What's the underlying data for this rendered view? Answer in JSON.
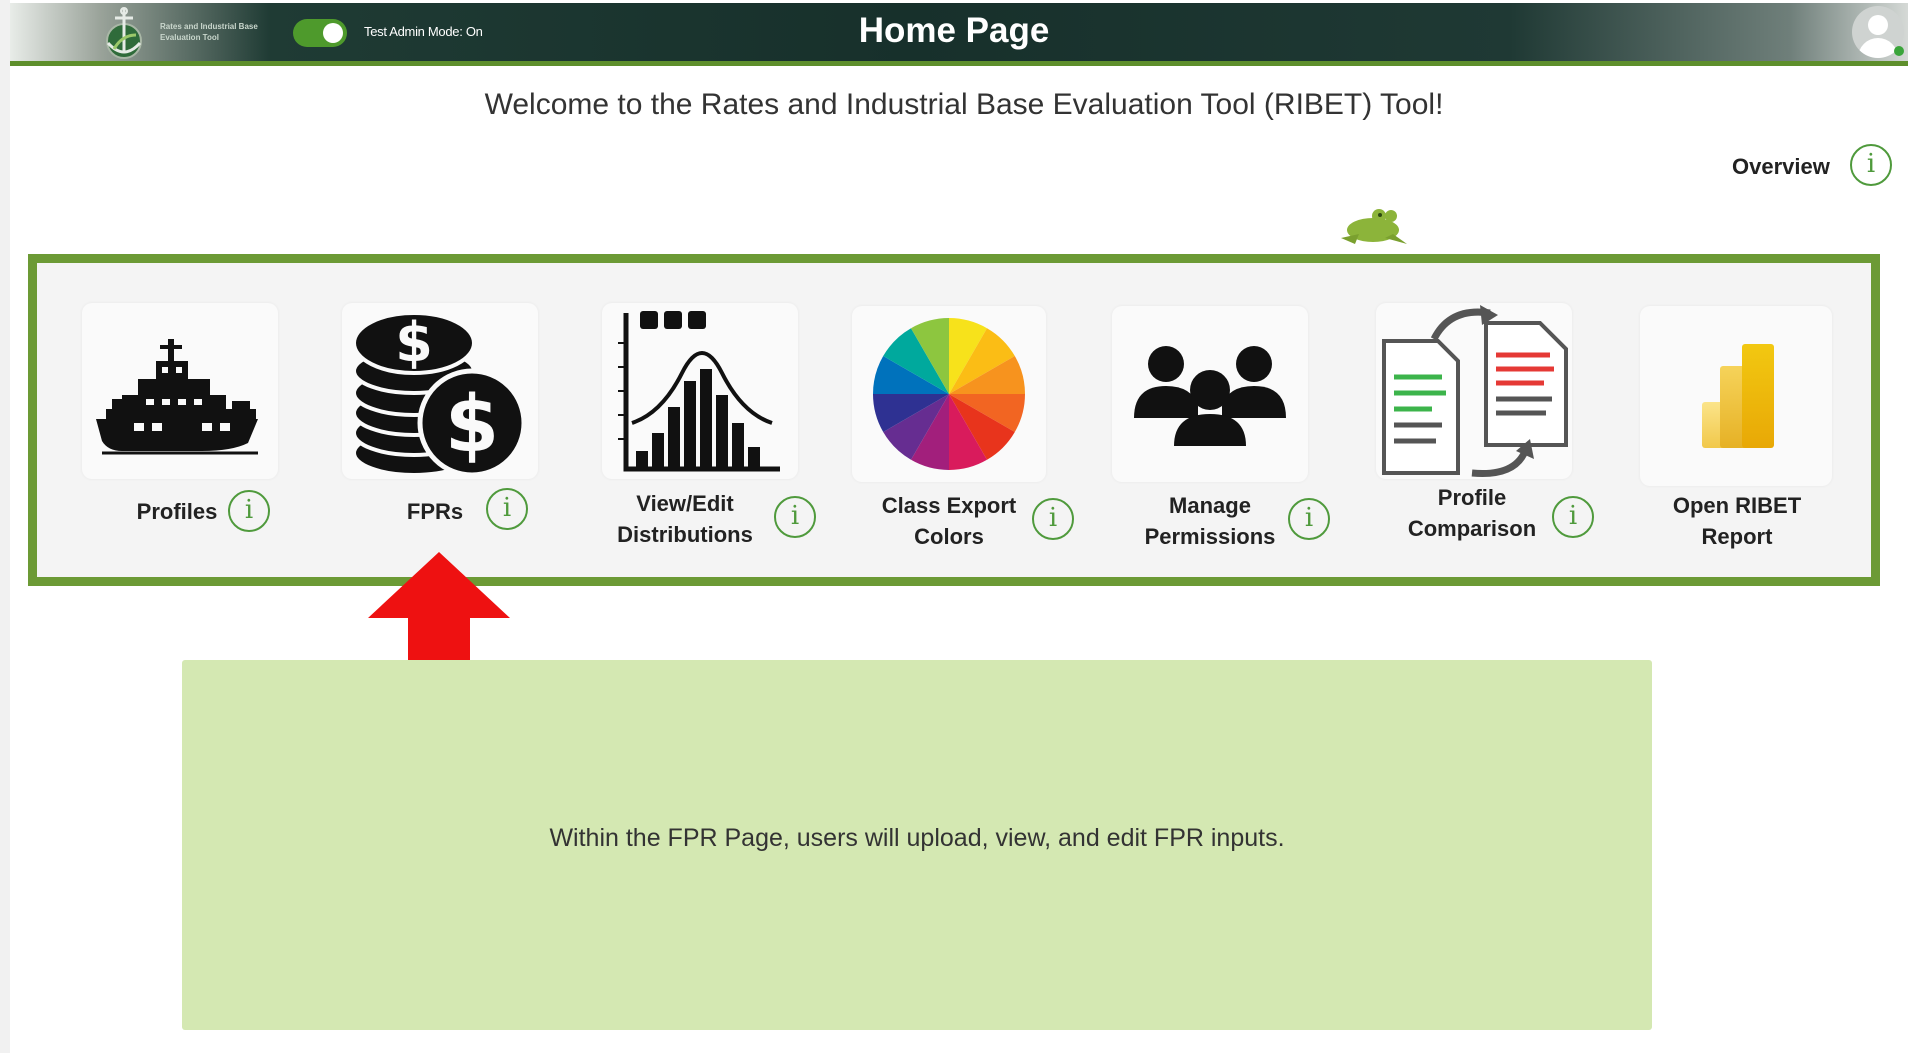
{
  "header": {
    "logo_text": "Rates and Industrial Base Evaluation Tool",
    "toggle_label": "Test Admin Mode: On",
    "title": "Home Page"
  },
  "welcome": "Welcome to the Rates and Industrial Base Evaluation Tool (RIBET) Tool!",
  "overview_label": "Overview",
  "info_glyph": "i",
  "tiles": [
    {
      "label": "Profiles",
      "icon": "ship-icon"
    },
    {
      "label": "FPRs",
      "icon": "coins-dollar-icon"
    },
    {
      "label": "View/Edit\nDistributions",
      "icon": "distribution-chart-icon"
    },
    {
      "label": "Class Export\nColors",
      "icon": "color-wheel-icon"
    },
    {
      "label": "Manage\nPermissions",
      "icon": "people-group-icon"
    },
    {
      "label": "Profile\nComparison",
      "icon": "document-compare-icon"
    },
    {
      "label": "Open RIBET\nReport",
      "icon": "powerbi-icon"
    }
  ],
  "info_box_text": "Within the FPR Page, users will upload, view, and edit FPR inputs.",
  "colors": {
    "header_bg": "#17302b",
    "accent_green": "#6c9a35",
    "info_box_bg": "#d4e8b2",
    "arrow_red": "#ee1111"
  }
}
